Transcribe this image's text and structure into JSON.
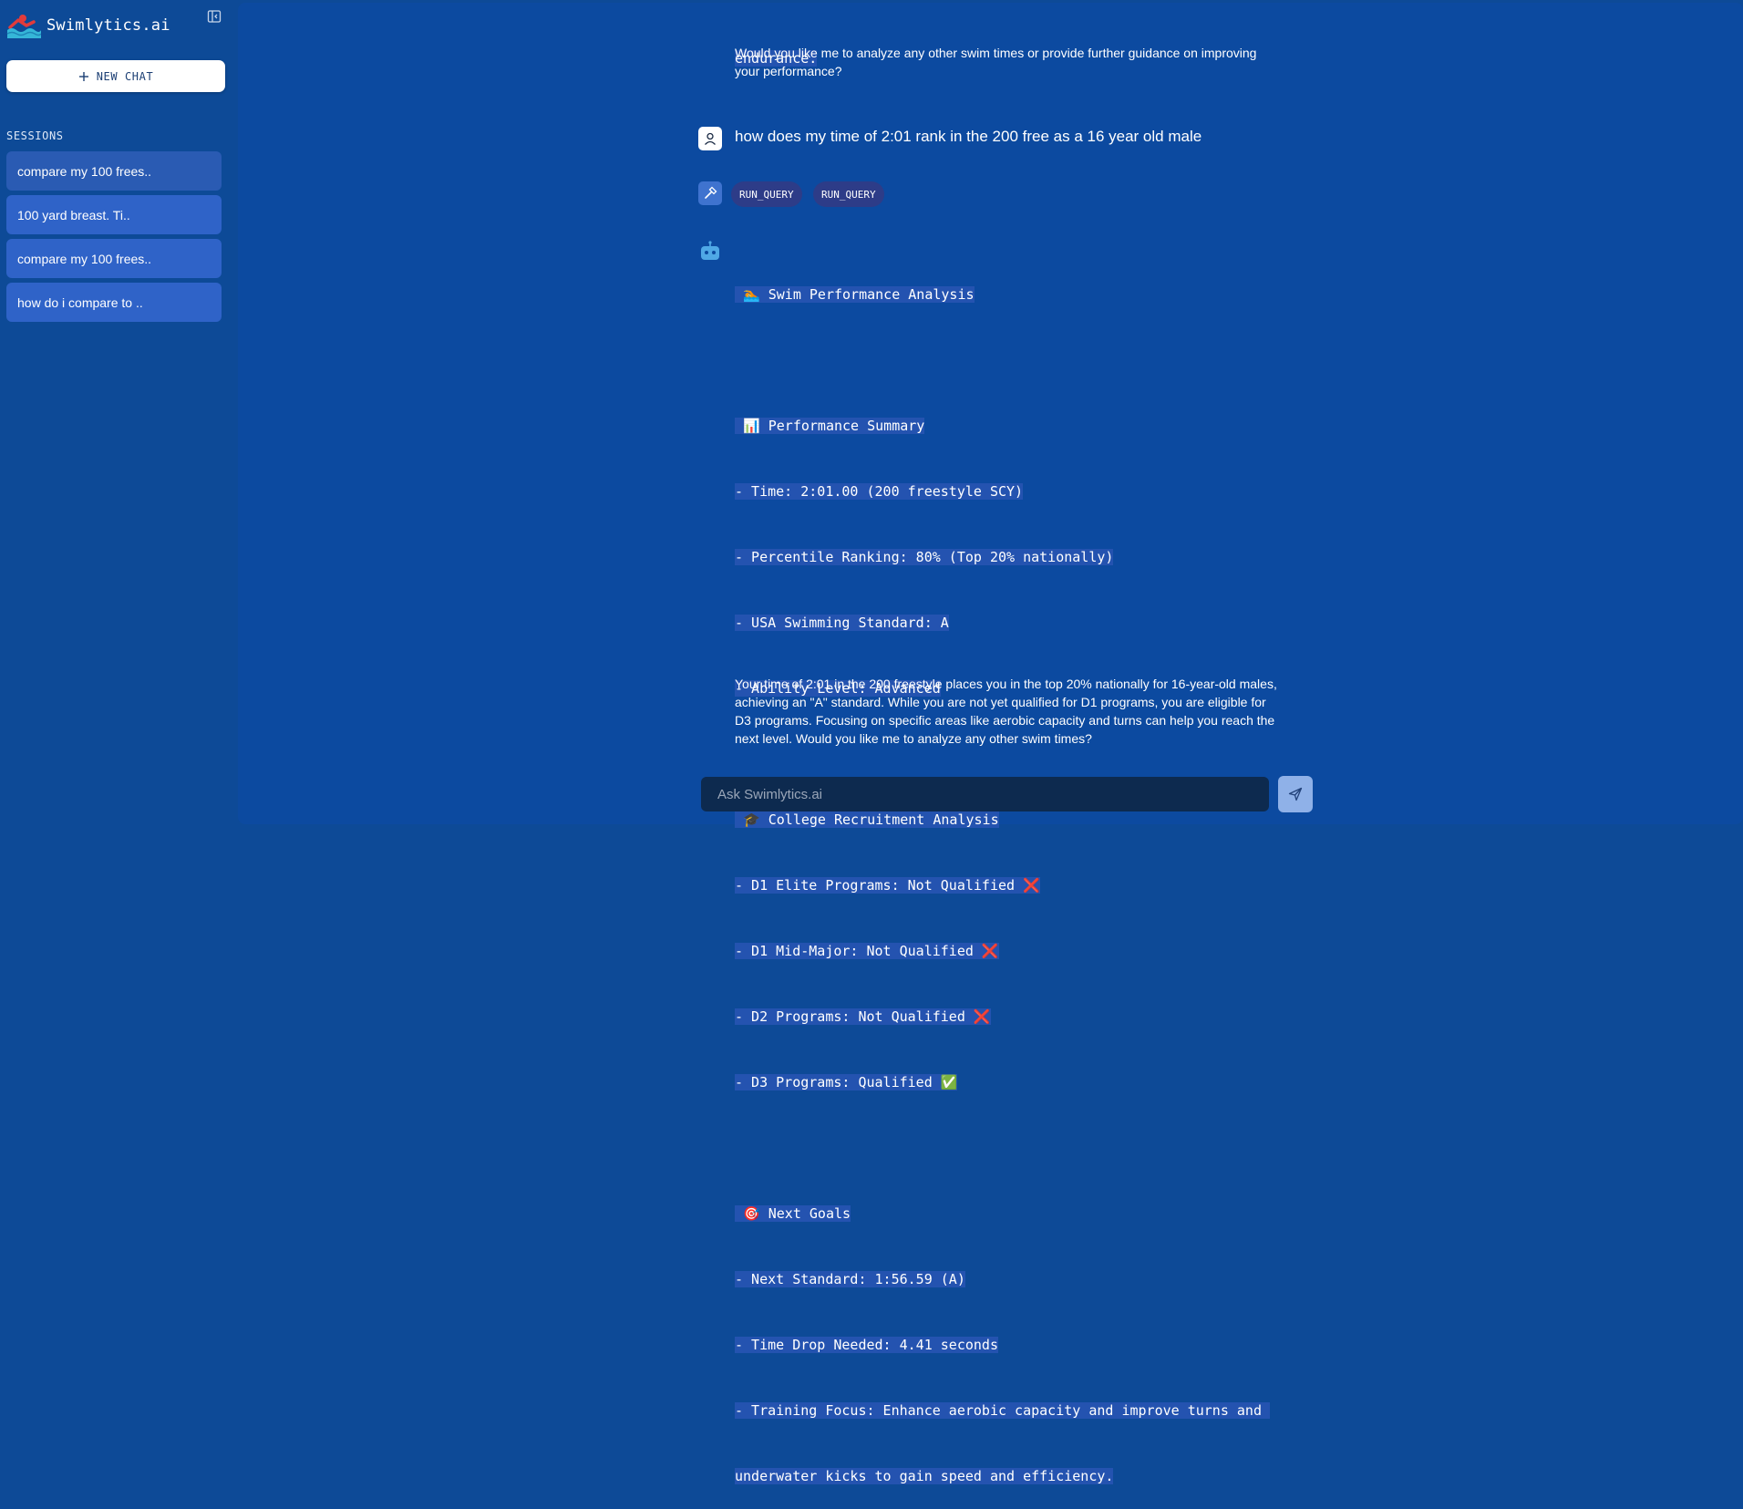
{
  "sidebar": {
    "brand": "Swimlytics.ai",
    "new_chat_label": "NEW CHAT",
    "sessions_title": "SESSIONS",
    "sessions": [
      "compare my 100 frees..",
      "100 yard breast. Ti..",
      "compare my 100 frees..",
      "how do i compare to .."
    ]
  },
  "conversation": {
    "prev_assistant_tail": "endurance.",
    "prev_assistant_followup": "Would you like me to analyze any other swim times or provide further guidance on improving your performance?",
    "user_message": "how does my time of 2:01 rank in the 200 free as a 16 year old male",
    "tool_calls": [
      "RUN_QUERY",
      "RUN_QUERY"
    ],
    "analysis_lines": [
      " 🏊 Swim Performance Analysis",
      "",
      " 📊 Performance Summary",
      "- Time: 2:01.00 (200 freestyle SCY)",
      "- Percentile Ranking: 80% (Top 20% nationally)",
      "- USA Swimming Standard: A",
      "- Ability Level: Advanced",
      "",
      " 🎓 College Recruitment Analysis",
      "- D1 Elite Programs: Not Qualified ❌",
      "- D1 Mid-Major: Not Qualified ❌",
      "- D2 Programs: Not Qualified ❌",
      "- D3 Programs: Qualified ✅",
      "",
      " 🎯 Next Goals",
      "- Next Standard: 1:56.59 (A)",
      "- Time Drop Needed: 4.41 seconds",
      "- Training Focus: Enhance aerobic capacity and improve turns and ",
      "underwater kicks to gain speed and efficiency."
    ],
    "summary": "Your time of 2:01 in the 200 freestyle places you in the top 20% nationally for 16-year-old males, achieving an \"A\" standard. While you are not yet qualified for D1 programs, you are eligible for D3 programs. Focusing on specific areas like aerobic capacity and turns can help you reach the next level. Would you like me to analyze any other swim times?"
  },
  "composer": {
    "placeholder": "Ask Swimlytics.ai"
  },
  "icons": {
    "brand": "wave-logo-icon",
    "collapse": "sidebar-collapse-icon",
    "new_chat": "plus-icon",
    "user": "user-avatar-icon",
    "tool": "hammer-icon",
    "bot": "robot-icon",
    "send": "send-icon"
  },
  "colors": {
    "background": "#0d4a97",
    "session_item": "#2f63c8",
    "tool_chip": "#2d3c88",
    "code_highlight": "#2453b0",
    "composer": "#0d2a4f",
    "send_button": "#8fb1e8"
  }
}
